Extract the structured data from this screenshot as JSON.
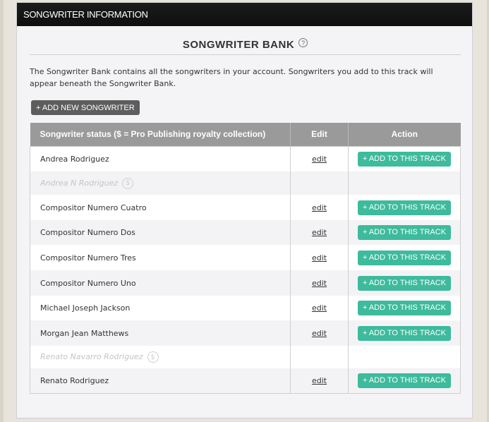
{
  "header": {
    "title": "SONGWRITER INFORMATION"
  },
  "bank": {
    "title": "SONGWRITER BANK",
    "help_glyph": "?",
    "description": "The Songwriter Bank contains all the songwriters in your account. Songwriters you add to this track will appear beneath the Songwriter Bank.",
    "add_new_label": "+ ADD NEW SONGWRITER"
  },
  "table": {
    "headers": {
      "status": "Songwriter status ($ = Pro Publishing royalty collection)",
      "edit": "Edit",
      "action": "Action"
    },
    "edit_label": "edit",
    "add_label": "+ ADD TO THIS TRACK",
    "dollar_glyph": "$",
    "rows": [
      {
        "name": "Andrea Rodriguez"
      },
      {
        "name": "Andrea N Rodriguez"
      },
      {
        "name": "Compositor Numero Cuatro"
      },
      {
        "name": "Compositor Numero Dos"
      },
      {
        "name": "Compositor Numero Tres"
      },
      {
        "name": "Compositor Numero Uno"
      },
      {
        "name": "Michael Joseph Jackson"
      },
      {
        "name": "Morgan Jean Matthews"
      },
      {
        "name": "Renato Navarro Rodriguez"
      },
      {
        "name": "Renato Rodriguez"
      }
    ]
  },
  "colors": {
    "accent": "#3dbb9c",
    "header_bg": "#111111",
    "table_header_bg": "#9a9a9a"
  }
}
